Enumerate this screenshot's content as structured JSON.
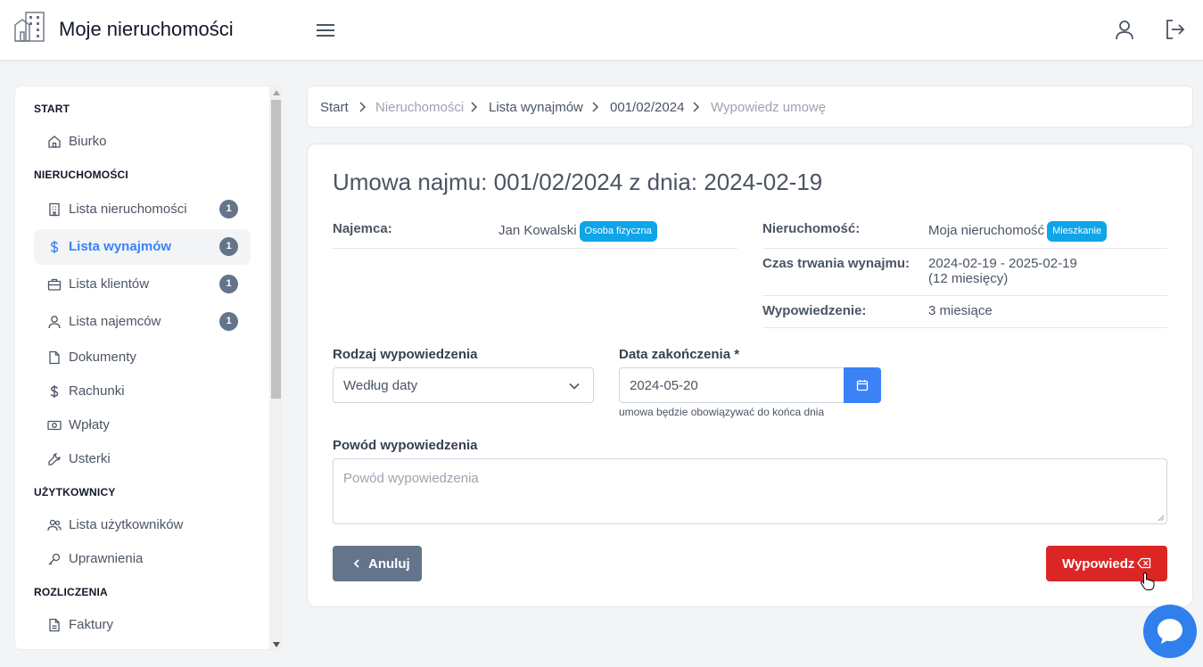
{
  "header": {
    "app_title": "Moje nieruchomości",
    "logo_icon": "building-logo-icon",
    "menu_icon": "hamburger-menu-icon",
    "user_icon": "user-icon",
    "logout_icon": "logout-icon"
  },
  "sidebar": {
    "sections": [
      {
        "title": "START"
      },
      {
        "title": "NIERUCHOMOŚCI"
      },
      {
        "title": "UŻYTKOWNICY"
      },
      {
        "title": "ROZLICZENIA"
      }
    ],
    "items": [
      {
        "label": "Biurko",
        "icon": "home-icon"
      },
      {
        "label": "Lista nieruchomości",
        "icon": "building-icon",
        "badge": "1"
      },
      {
        "label": "Lista wynajmów",
        "icon": "dollar-icon",
        "badge": "1",
        "active": true
      },
      {
        "label": "Lista klientów",
        "icon": "briefcase-icon",
        "badge": "1"
      },
      {
        "label": "Lista najemców",
        "icon": "user-icon",
        "badge": "1"
      },
      {
        "label": "Dokumenty",
        "icon": "document-icon"
      },
      {
        "label": "Rachunki",
        "icon": "dollar-icon"
      },
      {
        "label": "Wpłaty",
        "icon": "cash-icon"
      },
      {
        "label": "Usterki",
        "icon": "wrench-icon"
      },
      {
        "label": "Lista użytkowników",
        "icon": "users-icon"
      },
      {
        "label": "Uprawnienia",
        "icon": "key-icon"
      },
      {
        "label": "Faktury",
        "icon": "invoice-icon"
      }
    ]
  },
  "breadcrumb": {
    "items": [
      "Start",
      "Nieruchomości",
      "Lista wynajmów",
      "001/02/2024",
      "Wypowiedz umowę"
    ]
  },
  "card": {
    "title": "Umowa najmu: 001/02/2024 z dnia: 2024-02-19",
    "tenant_label": "Najemca:",
    "tenant_value": "Jan Kowalski",
    "tenant_type": "Osoba fizyczna",
    "property_label": "Nieruchomość:",
    "property_value": "Moja nieruchomość",
    "property_type": "Mieszkanie",
    "duration_label": "Czas trwania wynajmu:",
    "duration_value": "2024-02-19 - 2025-02-19",
    "duration_months": "(12 miesięcy)",
    "notice_label": "Wypowiedzenie:",
    "notice_value": "3 miesiące"
  },
  "form": {
    "type_label": "Rodzaj wypowiedzenia",
    "type_value": "Według daty",
    "end_date_label": "Data zakończenia",
    "required_mark": "*",
    "end_date_value": "2024-05-20",
    "end_date_hint": "umowa będzie obowiązywać do końca dnia",
    "reason_label": "Powód wypowiedzenia",
    "reason_placeholder": "Powód wypowiedzenia",
    "cancel_label": "Anuluj",
    "submit_label": "Wypowiedz"
  },
  "colors": {
    "primary": "#3b82f6",
    "danger": "#dc2626",
    "secondary": "#64748b",
    "pill": "#0ea5e9",
    "chat": "#2f80ed"
  }
}
